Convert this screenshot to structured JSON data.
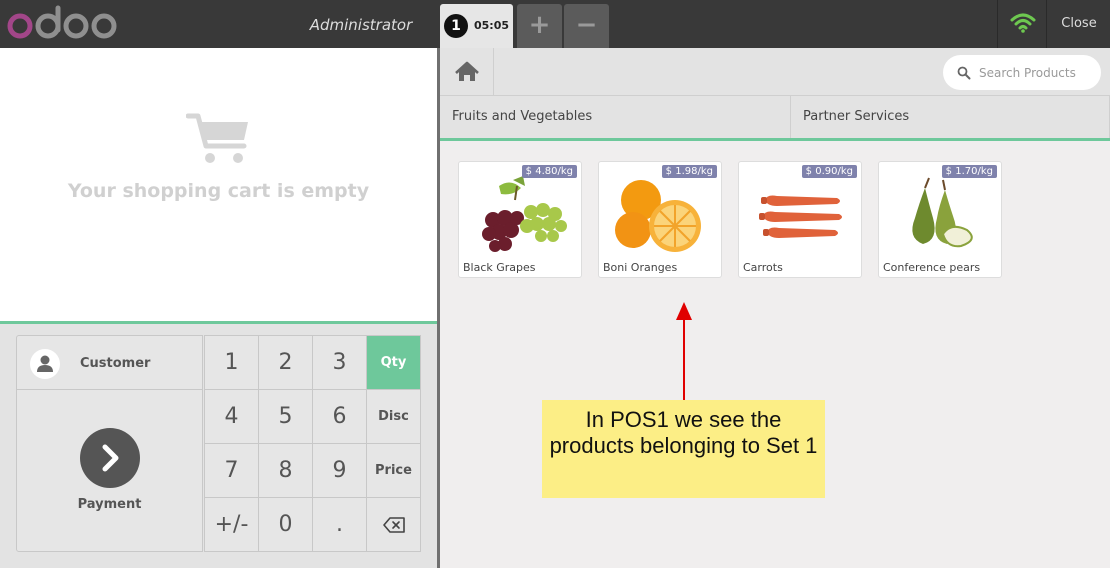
{
  "topbar": {
    "brand": "odoo",
    "username": "Administrator",
    "order_tab": {
      "number": "1",
      "time": "05:05"
    },
    "add_order_symbol": "+",
    "remove_order_symbol": "−",
    "close_label": "Close"
  },
  "cart": {
    "empty_message": "Your shopping cart is empty"
  },
  "actionpad": {
    "customer_label": "Customer",
    "payment_label": "Payment"
  },
  "numpad": {
    "keys": [
      "1",
      "2",
      "3",
      "4",
      "5",
      "6",
      "7",
      "8",
      "9",
      "+/-",
      "0",
      "."
    ],
    "modes": [
      "Qty",
      "Disc",
      "Price"
    ],
    "selected_mode": "Qty"
  },
  "search": {
    "placeholder": "Search Products"
  },
  "categories": [
    "Fruits and Vegetables",
    "Partner Services"
  ],
  "products": [
    {
      "name": "Black Grapes",
      "price": "$ 4.80/kg"
    },
    {
      "name": "Boni Oranges",
      "price": "$ 1.98/kg"
    },
    {
      "name": "Carrots",
      "price": "$ 0.90/kg"
    },
    {
      "name": "Conference pears",
      "price": "$ 1.70/kg"
    }
  ],
  "annotation": {
    "text": "In POS1 we see the products belonging to Set 1"
  },
  "colors": {
    "accent": "#6ec89b",
    "topbar": "#393939",
    "price_tag": "#7f82ac",
    "brand_purple": "#a24689",
    "annotation_bg": "#fcee86",
    "arrow": "#e00000"
  }
}
